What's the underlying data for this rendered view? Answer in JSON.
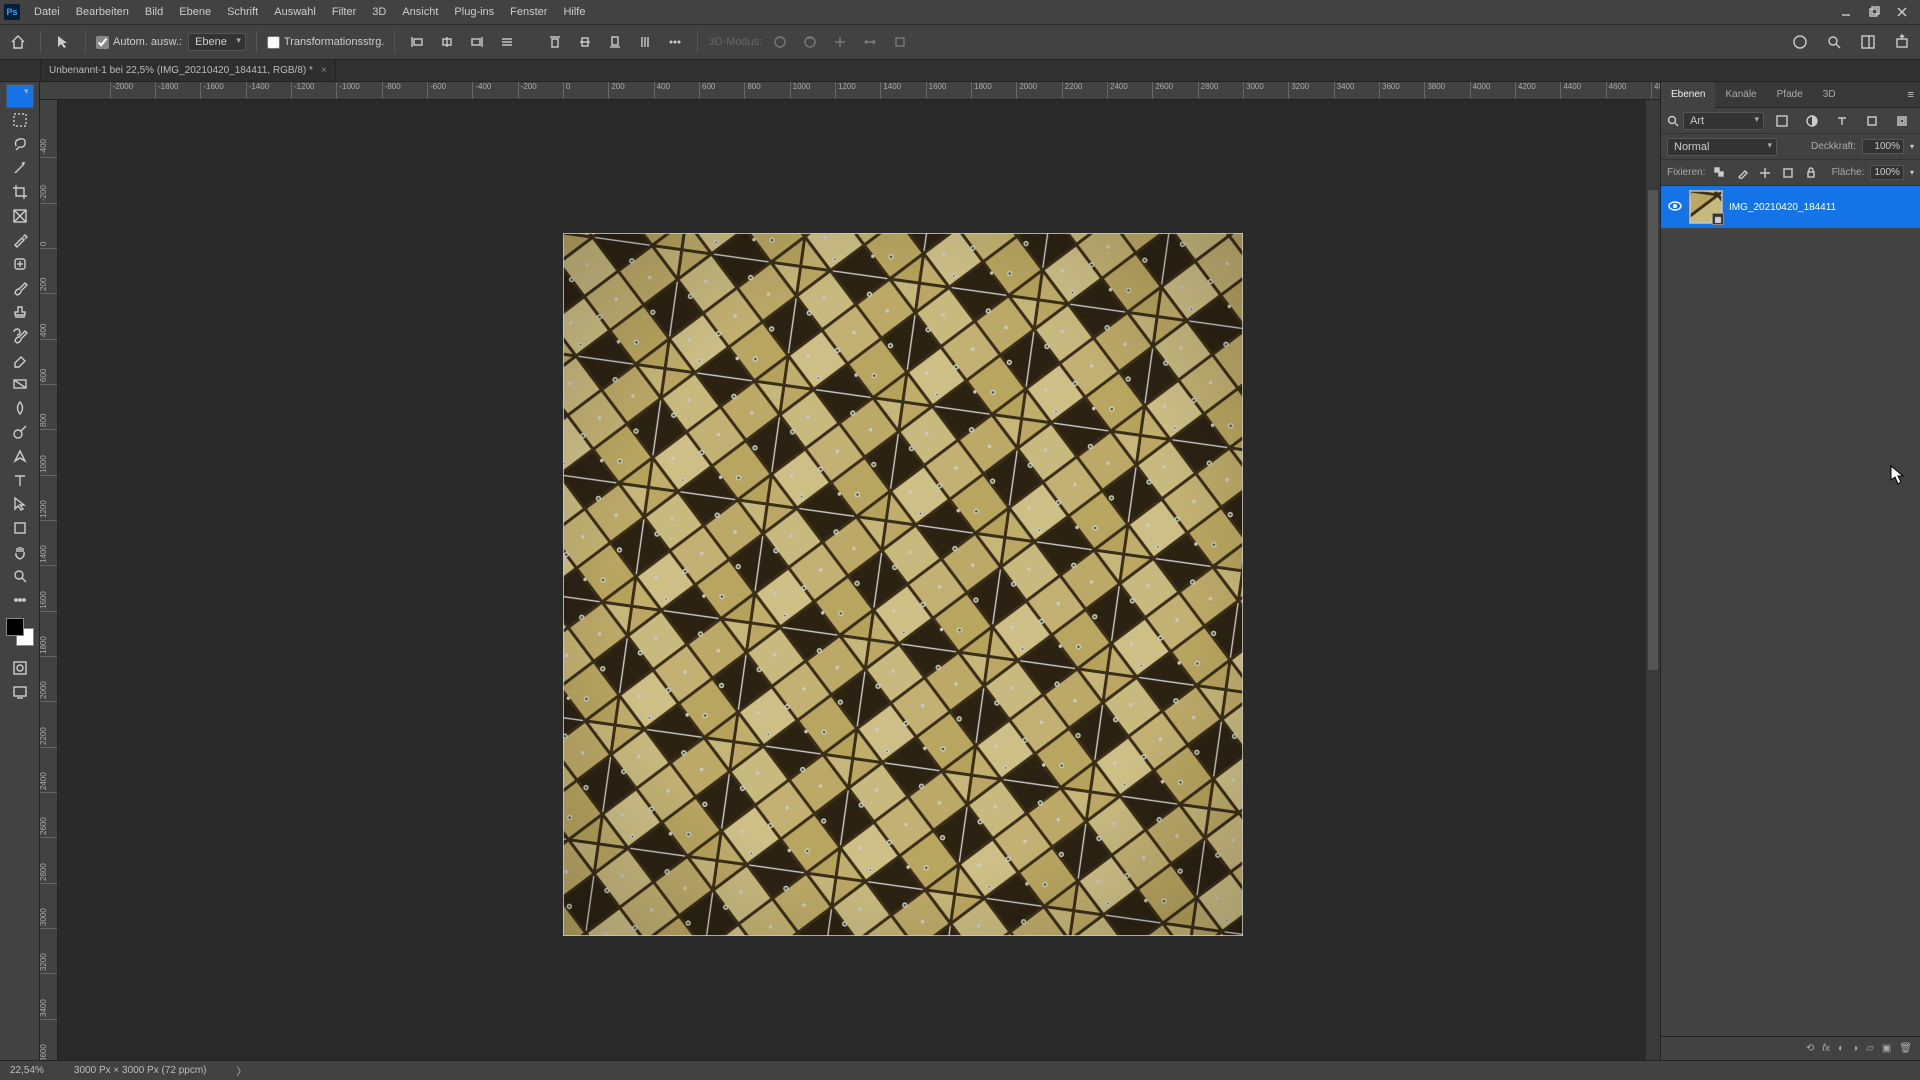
{
  "app": {
    "logo_text": "Ps"
  },
  "menu": [
    "Datei",
    "Bearbeiten",
    "Bild",
    "Ebene",
    "Schrift",
    "Auswahl",
    "Filter",
    "3D",
    "Ansicht",
    "Plug-ins",
    "Fenster",
    "Hilfe"
  ],
  "options": {
    "auto_select_checked": true,
    "auto_select_label": "Autom. ausw.:",
    "auto_select_target": "Ebene",
    "transform_controls_checked": false,
    "transform_controls_label": "Transformationsstrg.",
    "mode_3d_label": "3D-Modus:"
  },
  "document_tab": {
    "title": "Unbenannt-1 bei 22,5% (IMG_20210420_184411, RGB/8) *",
    "close_glyph": "×"
  },
  "ruler": {
    "h_start": -2000,
    "h_step": 200,
    "h_count": 36,
    "v_start": -600,
    "v_step": 200,
    "v_count": 24
  },
  "panel": {
    "tabs": [
      "Ebenen",
      "Kanäle",
      "Pfade",
      "3D"
    ],
    "active_tab": 0,
    "search_placeholder": "Art",
    "blend_mode": "Normal",
    "opacity_label": "Deckkraft:",
    "opacity_value": "100%",
    "lock_label": "Fixieren:",
    "fill_label": "Fläche:",
    "fill_value": "100%",
    "layer": {
      "visible_glyph": "👁",
      "name": "IMG_20210420_184411",
      "smart_object_glyph": "▦"
    },
    "footer_icons": [
      "⟲",
      "fx",
      "◐",
      "◑",
      "▱",
      "▣",
      "🗑"
    ]
  },
  "status": {
    "zoom": "22,54%",
    "info": "3000 Px × 3000 Px (72 ppcm)",
    "arrow": "〉"
  },
  "icons": {
    "home": "home",
    "move": "move",
    "marquee": "marquee",
    "lasso": "lasso",
    "wand": "wand",
    "crop": "crop",
    "frame": "frame",
    "eyedrop": "eyedrop",
    "heal": "heal",
    "brush": "brush",
    "stamp": "stamp",
    "history": "history",
    "eraser": "eraser",
    "gradient": "gradient",
    "blur": "blur",
    "dodge": "dodge",
    "pen": "pen",
    "type": "type",
    "path": "path",
    "rect": "rect",
    "hand": "hand",
    "zoom": "zoom",
    "swap": "swap",
    "mask": "mask",
    "more": "more"
  }
}
